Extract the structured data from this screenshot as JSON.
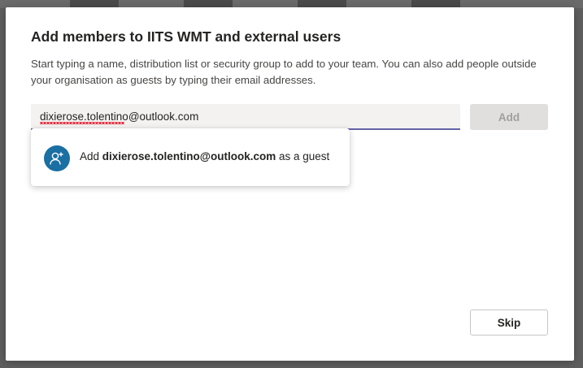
{
  "dialog": {
    "title": "Add members to IITS WMT and external users",
    "description": "Start typing a name, distribution list or security group to add to your team. You can also add people outside your organisation as guests by typing their email addresses."
  },
  "search": {
    "value": "dixierose.tolentino@outlook.com"
  },
  "buttons": {
    "add_label": "Add",
    "skip_label": "Skip"
  },
  "suggestion": {
    "prefix": "Add ",
    "email": "dixierose.tolentino@outlook.com",
    "suffix": " as a guest",
    "icon": "add-guest-icon"
  },
  "colors": {
    "accent": "#6264a7",
    "avatar": "#1a6fa3",
    "disabled_bg": "#e1dfdd",
    "disabled_text": "#a19f9d"
  }
}
